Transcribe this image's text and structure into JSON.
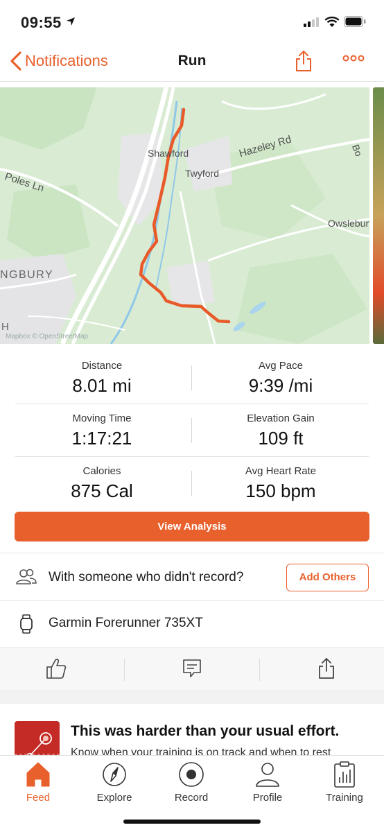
{
  "status": {
    "time": "09:55"
  },
  "nav": {
    "back_label": "Notifications",
    "title": "Run"
  },
  "map": {
    "labels": {
      "shawford": "Shawford",
      "twyford": "Twyford",
      "hazeley": "Hazeley Rd",
      "poles": "Poles Ln",
      "owslebury": "Owslebury",
      "ngbury": "NGBURY",
      "h": "H",
      "credit": "Mapbox  © OpenStreetMap",
      "edge": "Bo"
    }
  },
  "stats": [
    {
      "left": {
        "label": "Distance",
        "value": "8.01 mi"
      },
      "right": {
        "label": "Avg Pace",
        "value": "9:39 /mi"
      }
    },
    {
      "left": {
        "label": "Moving Time",
        "value": "1:17:21"
      },
      "right": {
        "label": "Elevation Gain",
        "value": "109 ft"
      }
    },
    {
      "left": {
        "label": "Calories",
        "value": "875 Cal"
      },
      "right": {
        "label": "Avg Heart Rate",
        "value": "150 bpm"
      }
    }
  ],
  "analysis_button": "View Analysis",
  "with_someone": {
    "text": "With someone who didn't record?",
    "button": "Add Others"
  },
  "device": "Garmin Forerunner 735XT",
  "insight": {
    "title": "This was harder than your usual effort.",
    "subtitle": "Know when your training is on track and when to rest"
  },
  "tabs": [
    {
      "label": "Feed",
      "icon": "home-icon",
      "active": true
    },
    {
      "label": "Explore",
      "icon": "compass-icon",
      "active": false
    },
    {
      "label": "Record",
      "icon": "record-icon",
      "active": false
    },
    {
      "label": "Profile",
      "icon": "profile-icon",
      "active": false
    },
    {
      "label": "Training",
      "icon": "training-icon",
      "active": false
    }
  ],
  "colors": {
    "accent": "#e8602c",
    "route": "#e85a2a"
  }
}
